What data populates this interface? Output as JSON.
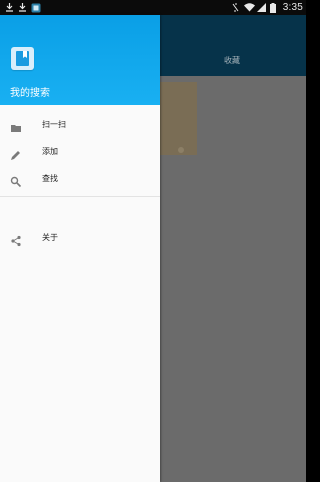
{
  "status_bar": {
    "time": "3:35",
    "left_icons": [
      "download-icon",
      "download-icon",
      "app-notification-icon"
    ],
    "right_icons": [
      "vibrate-icon",
      "wifi-icon",
      "signal-icon",
      "battery-icon"
    ]
  },
  "main": {
    "tab_label": "收藏"
  },
  "drawer": {
    "header_title": "我的搜索",
    "items": [
      {
        "label": "扫一扫",
        "icon": "folder-icon"
      },
      {
        "label": "添加",
        "icon": "pencil-icon"
      },
      {
        "label": "查找",
        "icon": "search-icon"
      },
      {
        "label": "关于",
        "icon": "share-icon"
      }
    ]
  },
  "colors": {
    "header": "#0a9fe6",
    "app_bar": "#06334a",
    "scrim": "#6b6b6b",
    "drawer_bg": "#fafafa"
  }
}
